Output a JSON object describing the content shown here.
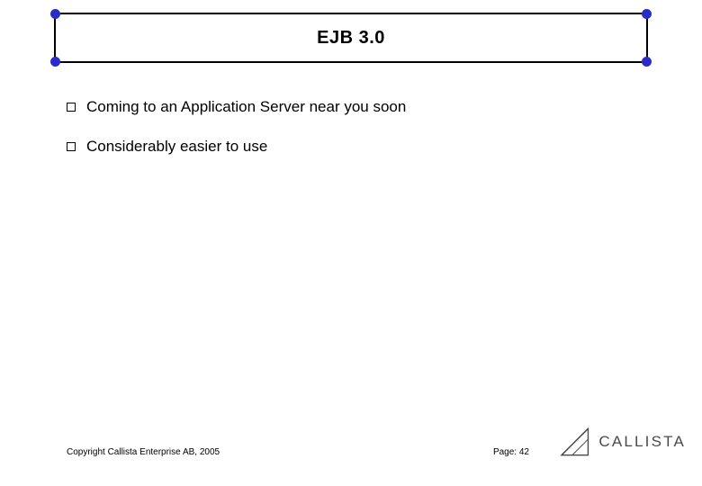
{
  "title": "EJB 3.0",
  "bullets": [
    "Coming to an Application Server near you soon",
    "Considerably easier to use"
  ],
  "footer": {
    "copyright": "Copyright Callista Enterprise AB, 2005",
    "page_label": "Page:",
    "page_number": "42"
  },
  "logo": {
    "text": "CALLISTA"
  }
}
